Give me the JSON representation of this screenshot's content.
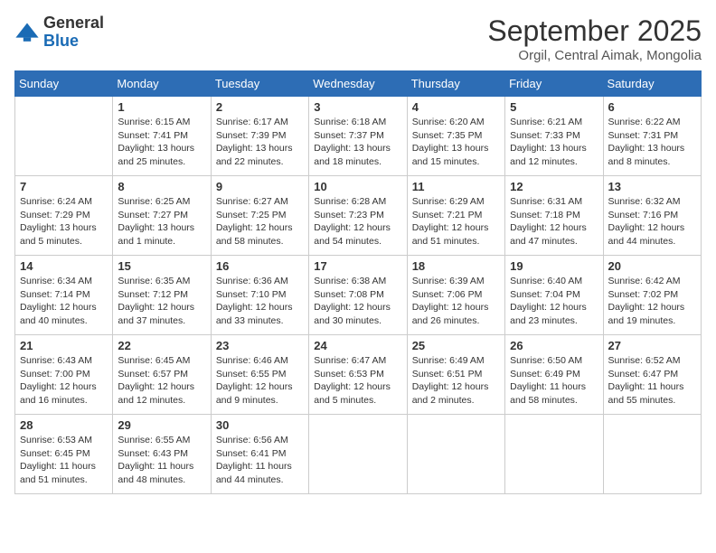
{
  "logo": {
    "general": "General",
    "blue": "Blue"
  },
  "header": {
    "month": "September 2025",
    "location": "Orgil, Central Aimak, Mongolia"
  },
  "weekdays": [
    "Sunday",
    "Monday",
    "Tuesday",
    "Wednesday",
    "Thursday",
    "Friday",
    "Saturday"
  ],
  "weeks": [
    [
      {
        "day": "",
        "info": ""
      },
      {
        "day": "1",
        "info": "Sunrise: 6:15 AM\nSunset: 7:41 PM\nDaylight: 13 hours\nand 25 minutes."
      },
      {
        "day": "2",
        "info": "Sunrise: 6:17 AM\nSunset: 7:39 PM\nDaylight: 13 hours\nand 22 minutes."
      },
      {
        "day": "3",
        "info": "Sunrise: 6:18 AM\nSunset: 7:37 PM\nDaylight: 13 hours\nand 18 minutes."
      },
      {
        "day": "4",
        "info": "Sunrise: 6:20 AM\nSunset: 7:35 PM\nDaylight: 13 hours\nand 15 minutes."
      },
      {
        "day": "5",
        "info": "Sunrise: 6:21 AM\nSunset: 7:33 PM\nDaylight: 13 hours\nand 12 minutes."
      },
      {
        "day": "6",
        "info": "Sunrise: 6:22 AM\nSunset: 7:31 PM\nDaylight: 13 hours\nand 8 minutes."
      }
    ],
    [
      {
        "day": "7",
        "info": "Sunrise: 6:24 AM\nSunset: 7:29 PM\nDaylight: 13 hours\nand 5 minutes."
      },
      {
        "day": "8",
        "info": "Sunrise: 6:25 AM\nSunset: 7:27 PM\nDaylight: 13 hours\nand 1 minute."
      },
      {
        "day": "9",
        "info": "Sunrise: 6:27 AM\nSunset: 7:25 PM\nDaylight: 12 hours\nand 58 minutes."
      },
      {
        "day": "10",
        "info": "Sunrise: 6:28 AM\nSunset: 7:23 PM\nDaylight: 12 hours\nand 54 minutes."
      },
      {
        "day": "11",
        "info": "Sunrise: 6:29 AM\nSunset: 7:21 PM\nDaylight: 12 hours\nand 51 minutes."
      },
      {
        "day": "12",
        "info": "Sunrise: 6:31 AM\nSunset: 7:18 PM\nDaylight: 12 hours\nand 47 minutes."
      },
      {
        "day": "13",
        "info": "Sunrise: 6:32 AM\nSunset: 7:16 PM\nDaylight: 12 hours\nand 44 minutes."
      }
    ],
    [
      {
        "day": "14",
        "info": "Sunrise: 6:34 AM\nSunset: 7:14 PM\nDaylight: 12 hours\nand 40 minutes."
      },
      {
        "day": "15",
        "info": "Sunrise: 6:35 AM\nSunset: 7:12 PM\nDaylight: 12 hours\nand 37 minutes."
      },
      {
        "day": "16",
        "info": "Sunrise: 6:36 AM\nSunset: 7:10 PM\nDaylight: 12 hours\nand 33 minutes."
      },
      {
        "day": "17",
        "info": "Sunrise: 6:38 AM\nSunset: 7:08 PM\nDaylight: 12 hours\nand 30 minutes."
      },
      {
        "day": "18",
        "info": "Sunrise: 6:39 AM\nSunset: 7:06 PM\nDaylight: 12 hours\nand 26 minutes."
      },
      {
        "day": "19",
        "info": "Sunrise: 6:40 AM\nSunset: 7:04 PM\nDaylight: 12 hours\nand 23 minutes."
      },
      {
        "day": "20",
        "info": "Sunrise: 6:42 AM\nSunset: 7:02 PM\nDaylight: 12 hours\nand 19 minutes."
      }
    ],
    [
      {
        "day": "21",
        "info": "Sunrise: 6:43 AM\nSunset: 7:00 PM\nDaylight: 12 hours\nand 16 minutes."
      },
      {
        "day": "22",
        "info": "Sunrise: 6:45 AM\nSunset: 6:57 PM\nDaylight: 12 hours\nand 12 minutes."
      },
      {
        "day": "23",
        "info": "Sunrise: 6:46 AM\nSunset: 6:55 PM\nDaylight: 12 hours\nand 9 minutes."
      },
      {
        "day": "24",
        "info": "Sunrise: 6:47 AM\nSunset: 6:53 PM\nDaylight: 12 hours\nand 5 minutes."
      },
      {
        "day": "25",
        "info": "Sunrise: 6:49 AM\nSunset: 6:51 PM\nDaylight: 12 hours\nand 2 minutes."
      },
      {
        "day": "26",
        "info": "Sunrise: 6:50 AM\nSunset: 6:49 PM\nDaylight: 11 hours\nand 58 minutes."
      },
      {
        "day": "27",
        "info": "Sunrise: 6:52 AM\nSunset: 6:47 PM\nDaylight: 11 hours\nand 55 minutes."
      }
    ],
    [
      {
        "day": "28",
        "info": "Sunrise: 6:53 AM\nSunset: 6:45 PM\nDaylight: 11 hours\nand 51 minutes."
      },
      {
        "day": "29",
        "info": "Sunrise: 6:55 AM\nSunset: 6:43 PM\nDaylight: 11 hours\nand 48 minutes."
      },
      {
        "day": "30",
        "info": "Sunrise: 6:56 AM\nSunset: 6:41 PM\nDaylight: 11 hours\nand 44 minutes."
      },
      {
        "day": "",
        "info": ""
      },
      {
        "day": "",
        "info": ""
      },
      {
        "day": "",
        "info": ""
      },
      {
        "day": "",
        "info": ""
      }
    ]
  ]
}
